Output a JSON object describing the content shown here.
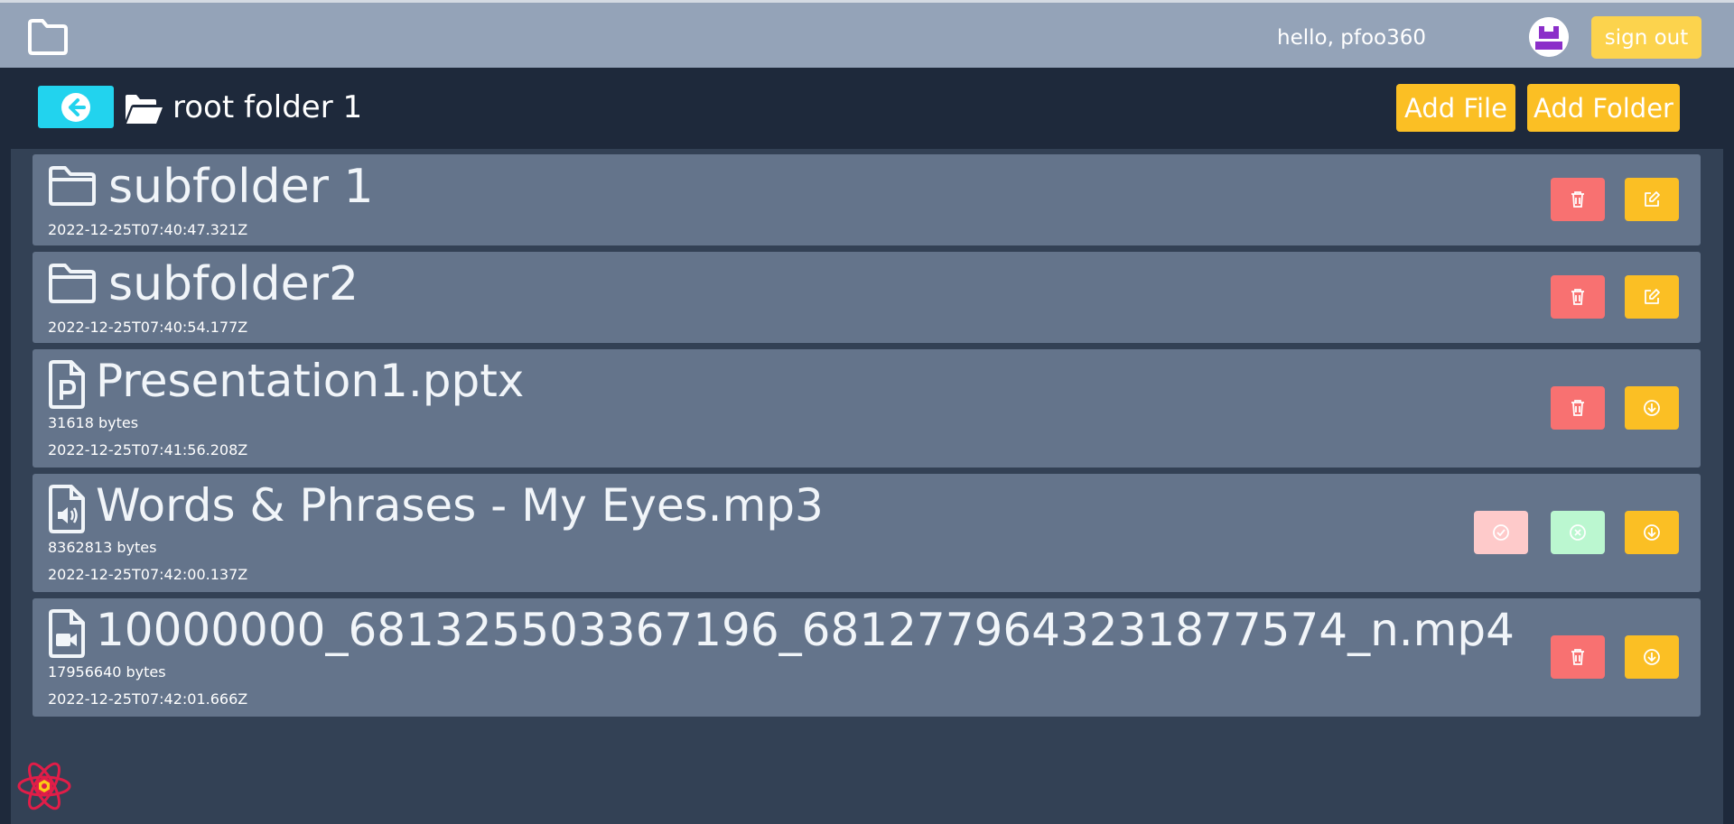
{
  "header": {
    "greeting": "hello, pfoo360",
    "sign_out_label": "sign out"
  },
  "toolbar": {
    "folder_name": "root folder 1",
    "add_file_label": "Add File",
    "add_folder_label": "Add Folder"
  },
  "items": [
    {
      "name": "subfolder 1",
      "date": "2022-12-25T07:40:47.321Z",
      "icon": "folder-icon"
    },
    {
      "name": "subfolder2",
      "date": "2022-12-25T07:40:54.177Z",
      "icon": "folder-icon"
    },
    {
      "name": "Presentation1.pptx",
      "size": "31618 bytes",
      "date": "2022-12-25T07:41:56.208Z",
      "icon": "powerpoint-file-icon"
    },
    {
      "name": "Words & Phrases - My Eyes.mp3",
      "size": "8362813 bytes",
      "date": "2022-12-25T07:42:00.137Z",
      "icon": "audio-file-icon"
    },
    {
      "name": "10000000_681325503367196_6812779643231877574_n.mp4",
      "size": "17956640 bytes",
      "date": "2022-12-25T07:42:01.666Z",
      "icon": "video-file-icon"
    }
  ],
  "colors": {
    "header": "#94a3b8",
    "background": "#1e293b",
    "panel": "#334155",
    "row": "#64748b",
    "accent_yellow": "#fbbf24",
    "accent_cyan": "#22d3ee",
    "danger": "#f87171"
  }
}
